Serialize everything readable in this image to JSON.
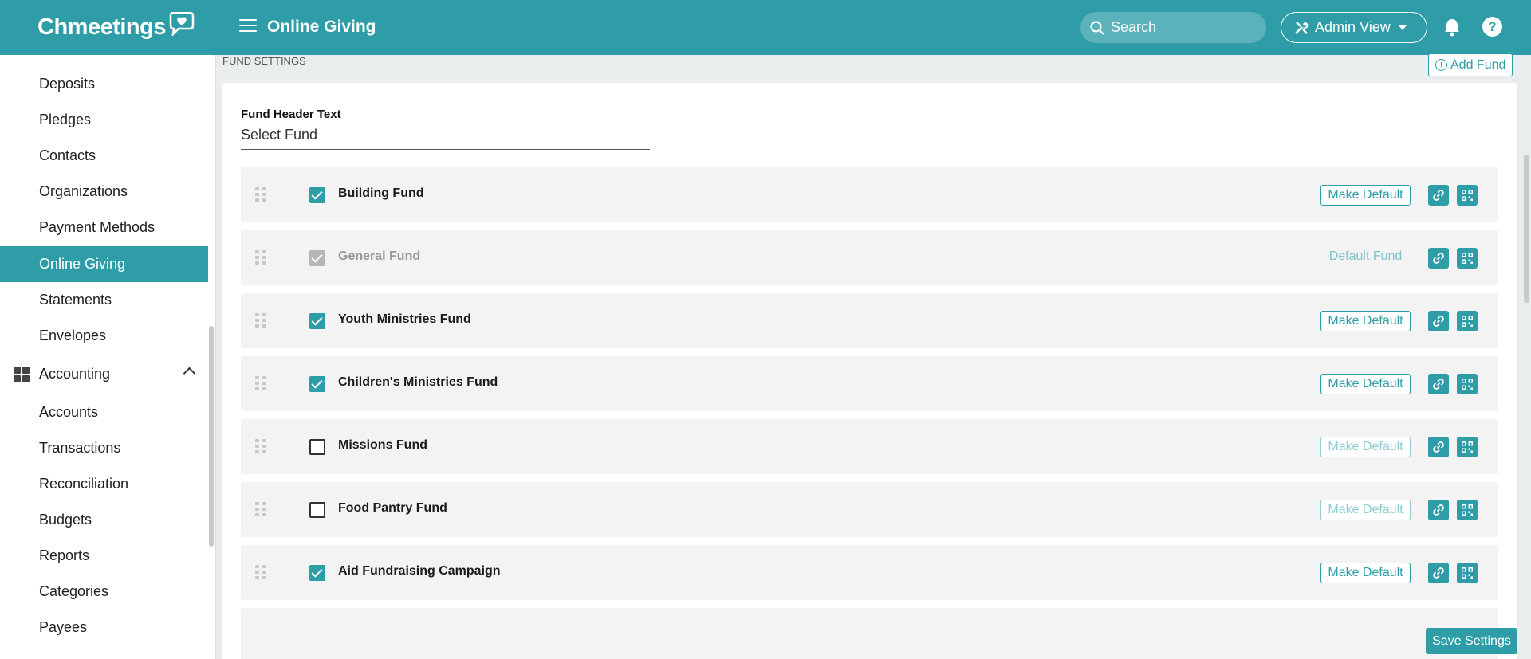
{
  "app": {
    "name": "Chmeetings",
    "page_title": "Online Giving"
  },
  "header": {
    "search_placeholder": "Search",
    "admin_view_label": "Admin View"
  },
  "sidebar": {
    "items": [
      {
        "label": "Deposits"
      },
      {
        "label": "Pledges"
      },
      {
        "label": "Contacts"
      },
      {
        "label": "Organizations"
      },
      {
        "label": "Payment Methods"
      },
      {
        "label": "Online Giving",
        "active": true
      },
      {
        "label": "Statements"
      },
      {
        "label": "Envelopes"
      }
    ],
    "section": {
      "label": "Accounting",
      "expanded": true
    },
    "sub_items": [
      {
        "label": "Accounts"
      },
      {
        "label": "Transactions"
      },
      {
        "label": "Reconciliation"
      },
      {
        "label": "Budgets"
      },
      {
        "label": "Reports"
      },
      {
        "label": "Categories"
      },
      {
        "label": "Payees"
      }
    ]
  },
  "fund_settings": {
    "section_label": "FUND SETTINGS",
    "add_fund_label": "Add Fund",
    "header_text_label": "Fund Header Text",
    "header_text_value": "Select Fund",
    "make_default_label": "Make Default",
    "default_fund_label": "Default Fund",
    "funds": [
      {
        "name": "Building Fund",
        "checked": true,
        "is_default": false
      },
      {
        "name": "General Fund",
        "checked": true,
        "is_default": true
      },
      {
        "name": "Youth Ministries Fund",
        "checked": true,
        "is_default": false
      },
      {
        "name": "Children's Ministries Fund",
        "checked": true,
        "is_default": false
      },
      {
        "name": "Missions Fund",
        "checked": false,
        "is_default": false
      },
      {
        "name": "Food Pantry Fund",
        "checked": false,
        "is_default": false
      },
      {
        "name": "Aid Fundraising Campaign",
        "checked": true,
        "is_default": false
      }
    ],
    "save_label": "Save Settings"
  },
  "colors": {
    "accent": "#2e9da7",
    "background": "#e9edee"
  }
}
